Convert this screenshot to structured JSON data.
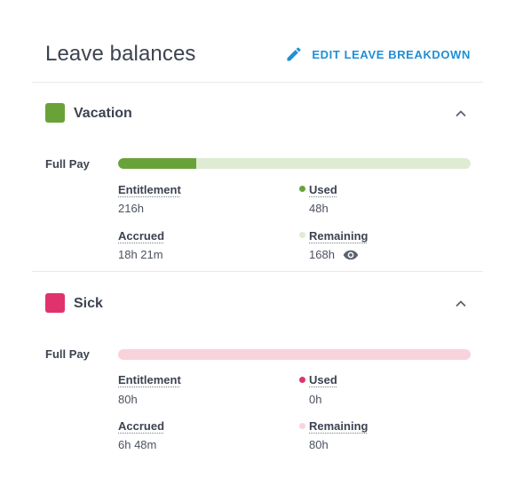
{
  "header": {
    "title": "Leave balances",
    "edit_label": "EDIT LEAVE BREAKDOWN"
  },
  "colors": {
    "accent": "#1e8fd6",
    "vacation": "#6aa23a",
    "vacation_light": "#dfebd3",
    "sick": "#e0336e",
    "sick_light": "#f9d3dc"
  },
  "sections": [
    {
      "name": "Vacation",
      "pay_label": "Full Pay",
      "used_fraction": 0.222,
      "entitlement_label": "Entitlement",
      "entitlement_value": "216h",
      "accrued_label": "Accrued",
      "accrued_value": "18h 21m",
      "used_label": "Used",
      "used_value": "48h",
      "remaining_label": "Remaining",
      "remaining_value": "168h"
    },
    {
      "name": "Sick",
      "pay_label": "Full Pay",
      "used_fraction": 0,
      "entitlement_label": "Entitlement",
      "entitlement_value": "80h",
      "accrued_label": "Accrued",
      "accrued_value": "6h 48m",
      "used_label": "Used",
      "used_value": "0h",
      "remaining_label": "Remaining",
      "remaining_value": "80h"
    }
  ]
}
